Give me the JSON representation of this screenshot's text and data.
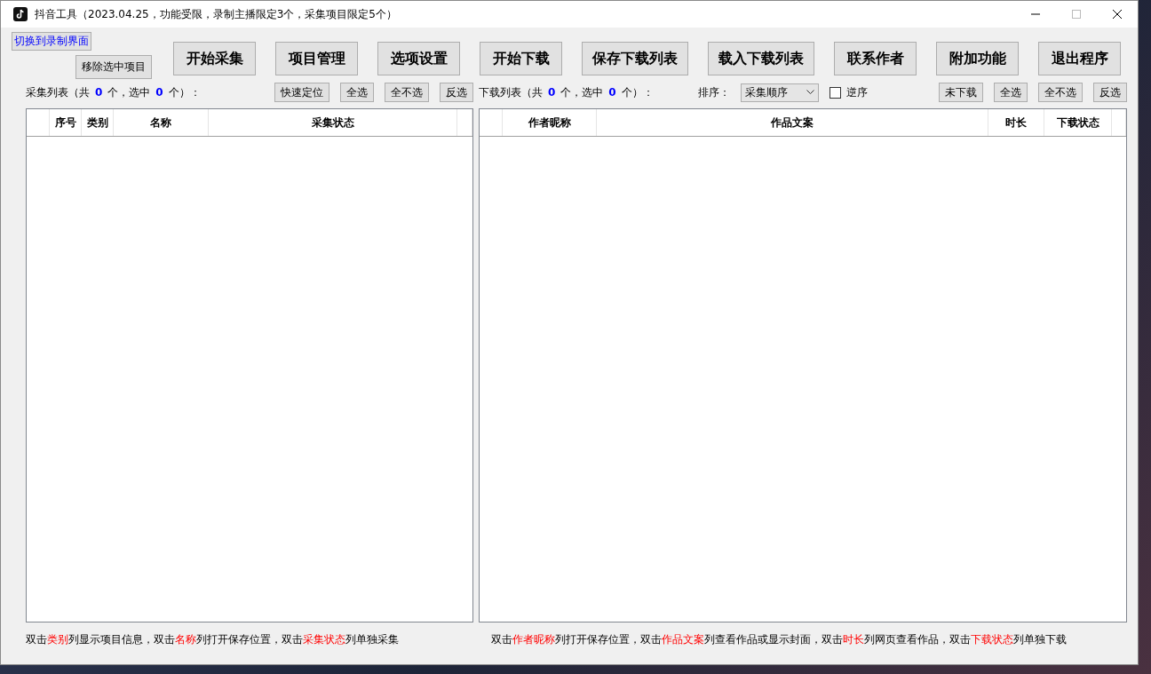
{
  "window": {
    "title": "抖音工具（2023.04.25，功能受限，录制主播限定3个，采集项目限定5个）"
  },
  "toolbar": {
    "switch_link": "切换到录制界面",
    "remove_button": "移除选中项目",
    "buttons": [
      "开始采集",
      "项目管理",
      "选项设置",
      "开始下载",
      "保存下载列表",
      "载入下载列表",
      "联系作者",
      "附加功能",
      "退出程序"
    ]
  },
  "collect_panel": {
    "label_parts": [
      {
        "text": "采集列表（共",
        "highlight": false
      },
      {
        "text": "0",
        "highlight": true
      },
      {
        "text": "个，选中",
        "highlight": false
      },
      {
        "text": "0",
        "highlight": true
      },
      {
        "text": "个）：",
        "highlight": false
      }
    ],
    "buttons": [
      "快速定位",
      "全选",
      "全不选",
      "反选"
    ],
    "columns": [
      "序号",
      "类别",
      "名称",
      "采集状态"
    ],
    "hint": [
      {
        "text": "双击",
        "highlight": false
      },
      {
        "text": "类别",
        "highlight": true
      },
      {
        "text": "列显示项目信息，双击",
        "highlight": false
      },
      {
        "text": "名称",
        "highlight": true
      },
      {
        "text": "列打开保存位置，双击",
        "highlight": false
      },
      {
        "text": "采集状态",
        "highlight": true
      },
      {
        "text": "列单独采集",
        "highlight": false
      }
    ]
  },
  "download_panel": {
    "label_parts": [
      {
        "text": "下载列表（共",
        "highlight": false
      },
      {
        "text": "0",
        "highlight": true
      },
      {
        "text": "个，选中",
        "highlight": false
      },
      {
        "text": "0",
        "highlight": true
      },
      {
        "text": "个）：",
        "highlight": false
      }
    ],
    "sort_label": "排序：",
    "sort_value": "采集顺序",
    "reverse": {
      "label": "逆序",
      "checked": false
    },
    "buttons": [
      "未下载",
      "全选",
      "全不选",
      "反选"
    ],
    "columns": [
      "作者昵称",
      "作品文案",
      "时长",
      "下载状态"
    ],
    "hint": [
      {
        "text": "双击",
        "highlight": false
      },
      {
        "text": "作者昵称",
        "highlight": true
      },
      {
        "text": "列打开保存位置，双击",
        "highlight": false
      },
      {
        "text": "作品文案",
        "highlight": true
      },
      {
        "text": "列查看作品或显示封面，双击",
        "highlight": false
      },
      {
        "text": "时长",
        "highlight": true
      },
      {
        "text": "列网页查看作品，双击",
        "highlight": false
      },
      {
        "text": "下载状态",
        "highlight": true
      },
      {
        "text": "列单独下载",
        "highlight": false
      }
    ]
  }
}
